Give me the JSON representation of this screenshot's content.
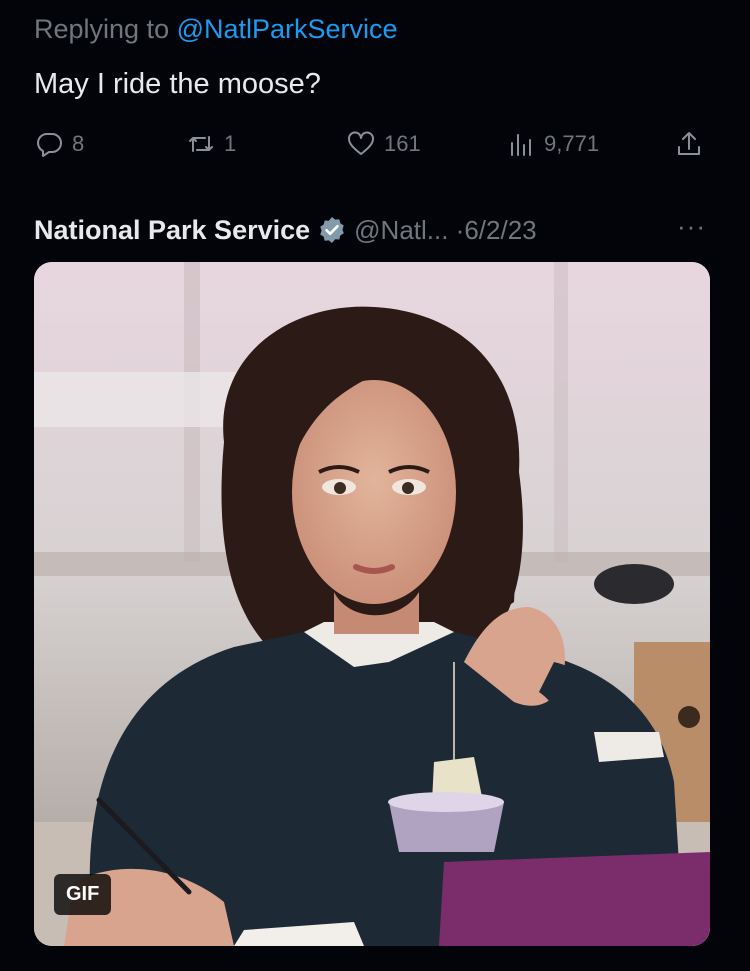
{
  "reply": {
    "prefix": "Replying to ",
    "handle": "@NatlParkService"
  },
  "tweet": {
    "text": "May I ride the moose?"
  },
  "actions": {
    "replies": "8",
    "retweets": "1",
    "likes": "161",
    "views": "9,771"
  },
  "quoted": {
    "author_name": "National Park Service",
    "meta": "@Natl... ·6/2/23",
    "more": "···",
    "media_badge": "GIF"
  },
  "colors": {
    "accent": "#1d9bf0",
    "muted": "#71767b",
    "text": "#e7e9ea",
    "background": "#02040a"
  },
  "icons": {
    "reply": "speech-bubble-icon",
    "retweet": "retweet-icon",
    "like": "heart-icon",
    "views": "bar-chart-icon",
    "share": "share-upload-icon",
    "verified": "verified-badge-icon",
    "more": "more-horizontal-icon"
  }
}
